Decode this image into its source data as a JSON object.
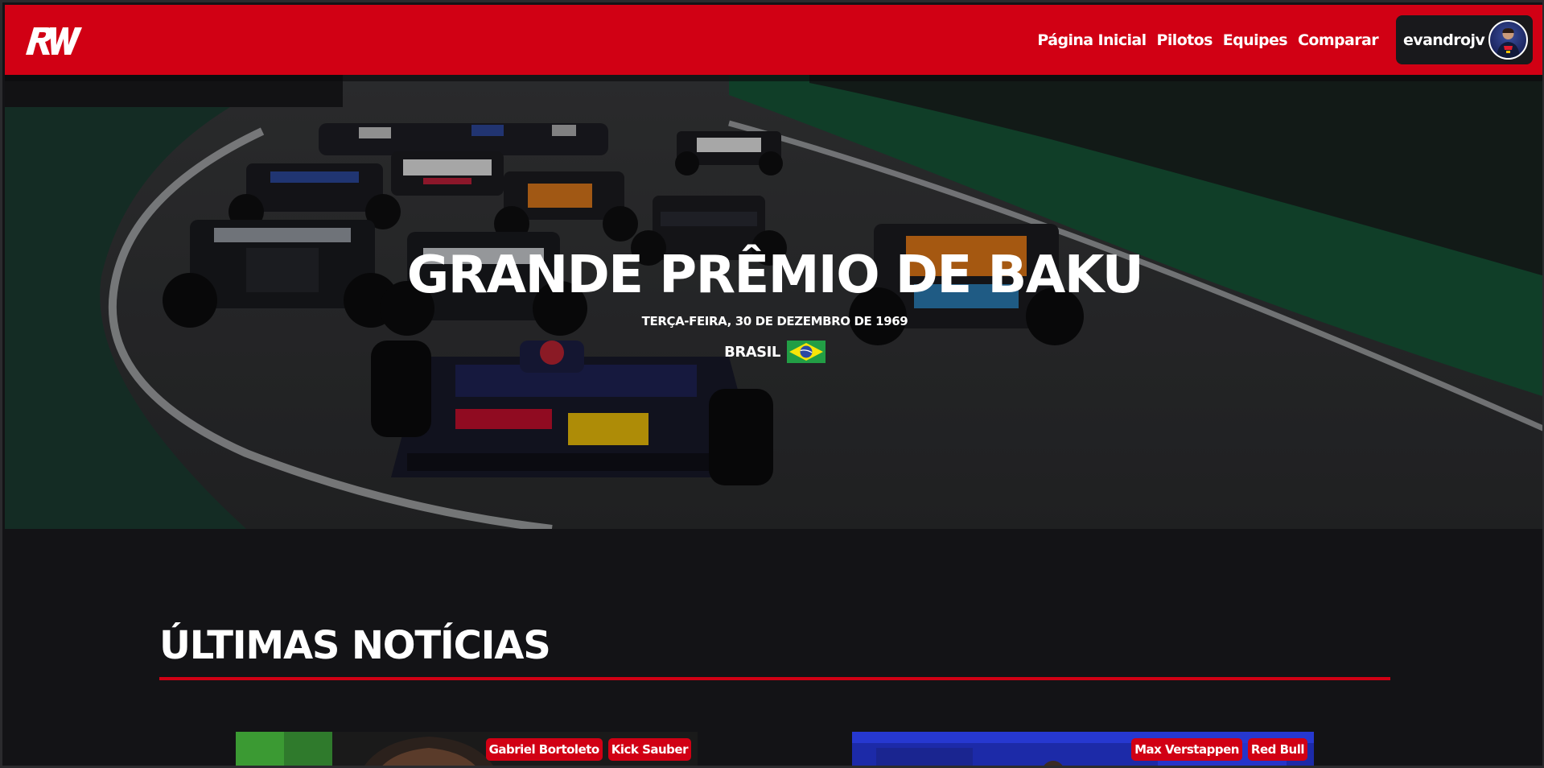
{
  "header": {
    "logo_icon": "rw-logo-icon",
    "nav": [
      {
        "label": "Página Inicial"
      },
      {
        "label": "Pilotos"
      },
      {
        "label": "Equipes"
      },
      {
        "label": "Comparar"
      }
    ],
    "user": {
      "name": "evandrojv",
      "avatar_icon": "user-avatar-icon"
    }
  },
  "hero": {
    "title": "GRANDE PRÊMIO DE BAKU",
    "date": "TERÇA-FEIRA, 30 DE DEZEMBRO DE 1969",
    "country": "BRASIL",
    "flag_icon": "brazil-flag-icon"
  },
  "news": {
    "title": "ÚLTIMAS NOTÍCIAS",
    "cards": [
      {
        "tags": [
          "Gabriel Bortoleto",
          "Kick Sauber"
        ]
      },
      {
        "tags": [
          "Max Verstappen",
          "Red Bull"
        ]
      }
    ]
  },
  "colors": {
    "brand": "#d10014",
    "background": "#131316",
    "user_chip": "#19191c"
  }
}
